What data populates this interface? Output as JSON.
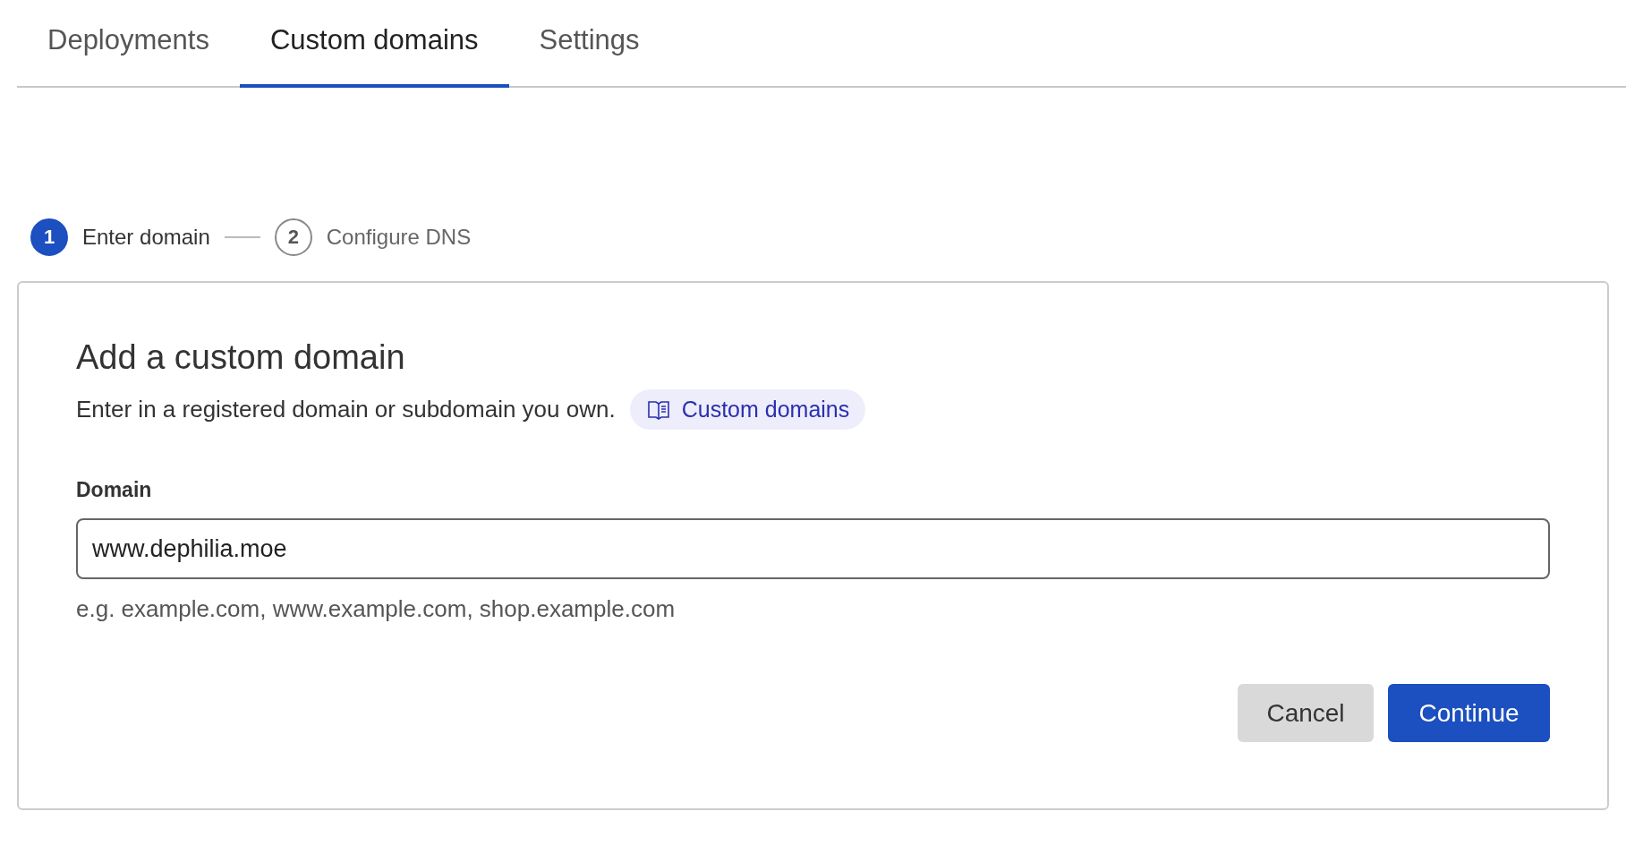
{
  "tabs": [
    {
      "label": "Deployments",
      "selected": false
    },
    {
      "label": "Custom domains",
      "selected": true
    },
    {
      "label": "Settings",
      "selected": false
    }
  ],
  "stepper": [
    {
      "number": "1",
      "label": "Enter domain",
      "selected": true
    },
    {
      "number": "2",
      "label": "Configure DNS",
      "selected": false
    }
  ],
  "card": {
    "title": "Add a custom domain",
    "description": "Enter in a registered domain or subdomain you own.",
    "docs_link": "Custom domains",
    "field": {
      "label": "Domain",
      "value": "www.dephilia.moe",
      "hint": "e.g. example.com, www.example.com, shop.example.com"
    },
    "buttons": [
      {
        "label": "Cancel",
        "kind": "secondary"
      },
      {
        "label": "Continue",
        "kind": "primary"
      }
    ]
  }
}
